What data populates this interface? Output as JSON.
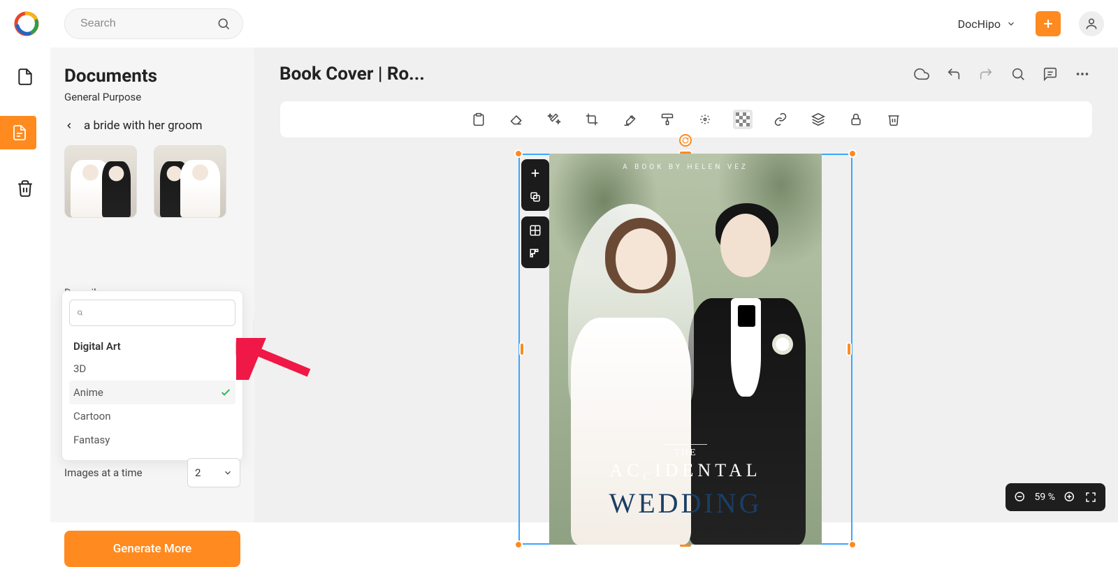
{
  "brand": "DocHipo",
  "search": {
    "placeholder": "Search"
  },
  "panel": {
    "title": "Documents",
    "subtitle": "General Purpose",
    "back_label": "a bride with her groom",
    "describe_label": "Describe",
    "style_search_placeholder": "",
    "style_group": "Digital Art",
    "styles": [
      "3D",
      "Anime",
      "Cartoon",
      "Fantasy"
    ],
    "selected_style": "Anime",
    "images_at_a_time_label": "Images at a time",
    "images_count": "2",
    "generate_label": "Generate More"
  },
  "editor": {
    "doc_title": "Book Cover | Ro...",
    "zoom": "59 %",
    "cover": {
      "byline": "A BOOK BY HELEN VEZ",
      "the": "THE",
      "line2a": "AC",
      "line2b": "C",
      "line2c": "IDENTAL",
      "line3": "WEDDING"
    }
  }
}
